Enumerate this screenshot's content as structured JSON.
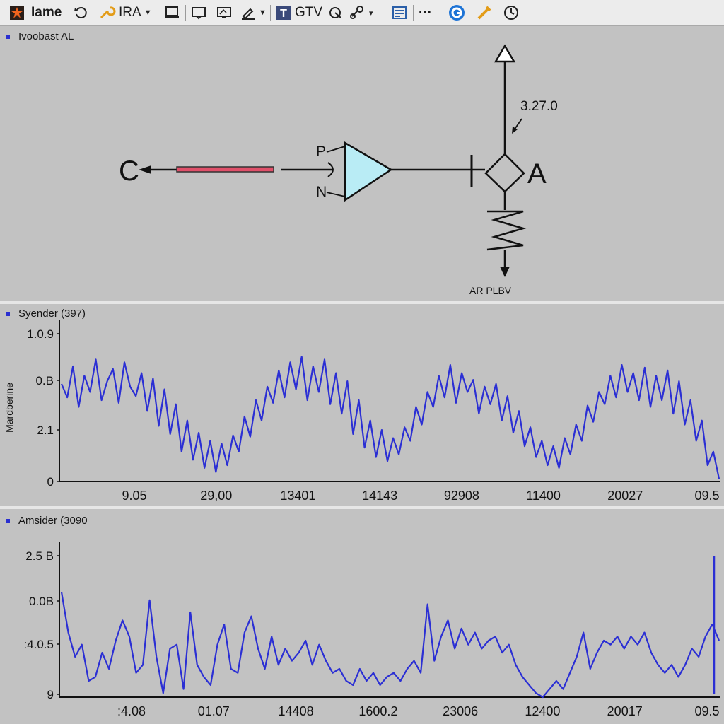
{
  "toolbar": {
    "app_name": "Iame",
    "tool_ira": "IRA",
    "tool_gtv": "GTV",
    "more": "···",
    "icons": [
      "app-logo-icon",
      "refresh-icon",
      "wrench-icon",
      "monitor-icon",
      "window-icon",
      "display-icon",
      "pen-icon",
      "text-tool-icon",
      "pointer-icon",
      "link-icon",
      "chart-icon",
      "browser-icon",
      "tool-icon",
      "clock-icon"
    ]
  },
  "schematic": {
    "title": "Ivoobast AL",
    "label_c": "C",
    "label_p": "P",
    "label_n": "N",
    "label_a": "A",
    "value": "3.27.0",
    "ground_label": "AR PLBV",
    "colors": {
      "resistor": "#e0506a",
      "amp_fill": "#b9ecf5"
    }
  },
  "chart1": {
    "title": "Syender (397)",
    "ylabel": "Mardberine",
    "yticks": [
      "1.0.9",
      "0.B",
      "2.1",
      "0"
    ],
    "xticks": [
      "9.05",
      "29,00",
      "13401",
      "14143",
      "92908",
      "11400",
      "20027",
      "09.5"
    ]
  },
  "chart2": {
    "title": "Amsider (3090",
    "yticks": [
      "2.5 B",
      "0.0B",
      ":4.0.5",
      "9"
    ],
    "xticks": [
      ":4.08",
      "01.07",
      "14408",
      "1600.2",
      "23006",
      "12400",
      "20017",
      "09.5"
    ]
  },
  "chart_data": [
    {
      "type": "line",
      "title": "Syender (397)",
      "ylabel": "Mardberine",
      "ylim": [
        0,
        1.09
      ],
      "line_color": "#2b2fd4",
      "series": [
        {
          "values": [
            0.72,
            0.62,
            0.85,
            0.55,
            0.78,
            0.66,
            0.9,
            0.6,
            0.74,
            0.83,
            0.58,
            0.88,
            0.7,
            0.63,
            0.8,
            0.52,
            0.76,
            0.41,
            0.68,
            0.35,
            0.57,
            0.22,
            0.45,
            0.16,
            0.36,
            0.1,
            0.3,
            0.07,
            0.28,
            0.12,
            0.34,
            0.22,
            0.48,
            0.33,
            0.6,
            0.45,
            0.7,
            0.58,
            0.82,
            0.62,
            0.88,
            0.68,
            0.92,
            0.6,
            0.85,
            0.66,
            0.9,
            0.57,
            0.8,
            0.5,
            0.74,
            0.35,
            0.6,
            0.25,
            0.45,
            0.18,
            0.38,
            0.15,
            0.32,
            0.2,
            0.4,
            0.3,
            0.55,
            0.42,
            0.66,
            0.55,
            0.78,
            0.62,
            0.86,
            0.58,
            0.8,
            0.66,
            0.75,
            0.5,
            0.7,
            0.57,
            0.72,
            0.45,
            0.63,
            0.36,
            0.52,
            0.26,
            0.4,
            0.18,
            0.3,
            0.12,
            0.26,
            0.1,
            0.32,
            0.2,
            0.42,
            0.3,
            0.56,
            0.44,
            0.66,
            0.57,
            0.78,
            0.62,
            0.86,
            0.66,
            0.8,
            0.6,
            0.84,
            0.55,
            0.78,
            0.6,
            0.82,
            0.5,
            0.74,
            0.42,
            0.6,
            0.3,
            0.45,
            0.12,
            0.22,
            0.02
          ]
        }
      ]
    },
    {
      "type": "line",
      "title": "Amsider (3090",
      "ylim": [
        -1.0,
        2.5
      ],
      "line_color": "#2b2fd4",
      "series": [
        {
          "values": [
            1.6,
            0.6,
            0.0,
            0.3,
            -0.6,
            -0.5,
            0.1,
            -0.3,
            0.4,
            0.9,
            0.5,
            -0.4,
            -0.2,
            1.4,
            0.0,
            -0.9,
            0.2,
            0.3,
            -0.8,
            1.1,
            -0.2,
            -0.5,
            -0.7,
            0.3,
            0.8,
            -0.3,
            -0.4,
            0.6,
            1.0,
            0.2,
            -0.3,
            0.5,
            -0.2,
            0.2,
            -0.1,
            0.1,
            0.4,
            -0.2,
            0.3,
            -0.1,
            -0.4,
            -0.3,
            -0.6,
            -0.7,
            -0.3,
            -0.6,
            -0.4,
            -0.7,
            -0.5,
            -0.4,
            -0.6,
            -0.3,
            -0.1,
            -0.4,
            1.3,
            -0.1,
            0.5,
            0.9,
            0.2,
            0.7,
            0.3,
            0.6,
            0.2,
            0.4,
            0.5,
            0.1,
            0.3,
            -0.2,
            -0.5,
            -0.7,
            -0.9,
            -1.0,
            -0.8,
            -0.6,
            -0.8,
            -0.4,
            0.0,
            0.6,
            -0.3,
            0.1,
            0.4,
            0.3,
            0.5,
            0.2,
            0.5,
            0.3,
            0.6,
            0.1,
            -0.2,
            -0.4,
            -0.2,
            -0.5,
            -0.2,
            0.2,
            0.0,
            0.5,
            0.8,
            0.4
          ]
        }
      ]
    }
  ]
}
